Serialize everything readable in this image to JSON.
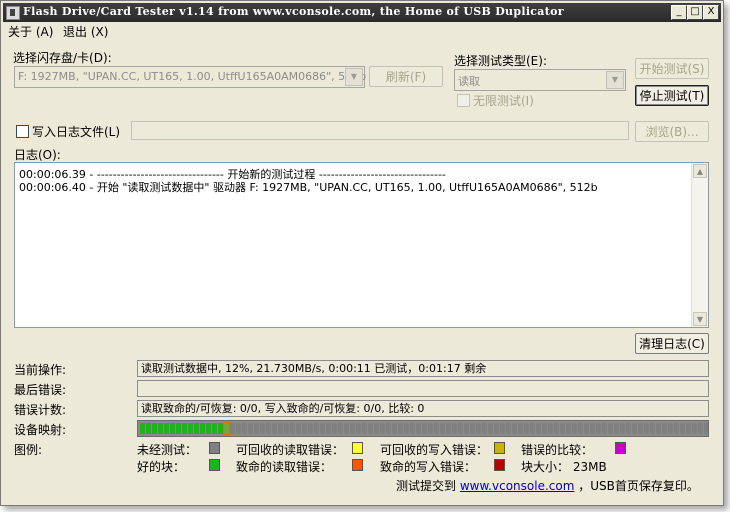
{
  "window": {
    "title": "Flash Drive/Card Tester v1.14 from www.vconsole.com, the Home of USB Duplicator"
  },
  "titlebar_buttons": {
    "minimize": "_",
    "maximize": "□",
    "close": "X"
  },
  "menu": {
    "about": "关于 (A)",
    "exit": "退出 (X)"
  },
  "drive": {
    "label": "选择闪存盘/卡(D):",
    "selected": "F: 1927MB, \"UPAN.CC, UT165, 1.00, UtffU165A0AM0686\", 512b",
    "refresh_label": "刷新(F)"
  },
  "test_type": {
    "label": "选择测试类型(E):",
    "selected": "读取",
    "infinite_label": "无限测试(I)"
  },
  "actions": {
    "start_label": "开始测试(S)",
    "stop_label": "停止测试(T)"
  },
  "logfile": {
    "label": "写入日志文件(L)",
    "value": "",
    "browse_label": "浏览(B)..."
  },
  "log": {
    "label": "日志(O):",
    "lines": [
      "00:00:06.39 - -------------------------------- 开始新的测试过程 --------------------------------",
      "00:00:06.40 - 开始 \"读取测试数据中\" 驱动器 F: 1927MB, \"UPAN.CC, UT165, 1.00, UtffU165A0AM0686\", 512b"
    ],
    "clear_label": "清理日志(C)"
  },
  "status": {
    "current_label": "当前操作:",
    "current_value": "读取测试数据中, 12%, 21.730MB/s, 0:00:11 已测试，0:01:17 剩余",
    "last_error_label": "最后错误:",
    "last_error_value": "",
    "error_count_label": "错误计数:",
    "error_count_value": "读取致命的/可恢复: 0/0, 写入致命的/可恢复: 0/0, 比较: 0"
  },
  "device_map": {
    "label": "设备映射:",
    "good_blocks": 14,
    "current_blocks": 1,
    "total_blocks": 114
  },
  "legend": {
    "label": "图例:",
    "items": [
      {
        "label": "未经测试：",
        "color": "#808080"
      },
      {
        "label": "可回收的读取错误：",
        "color": "#ffff33"
      },
      {
        "label": "可回收的写入错误：",
        "color": "#c8b400"
      },
      {
        "label": "错误的比较：",
        "color": "#cc00cc"
      },
      {
        "label": "好的块：",
        "color": "#11bb11"
      },
      {
        "label": "致命的读取错误：",
        "color": "#ff5500"
      },
      {
        "label": "致命的写入错误：",
        "color": "#bb0000"
      }
    ],
    "block_size": "块大小： 23MB"
  },
  "footer": {
    "prefix": "测试提交到",
    "link": "www.vconsole.com",
    "suffix": "，USB首页保存复印。"
  }
}
